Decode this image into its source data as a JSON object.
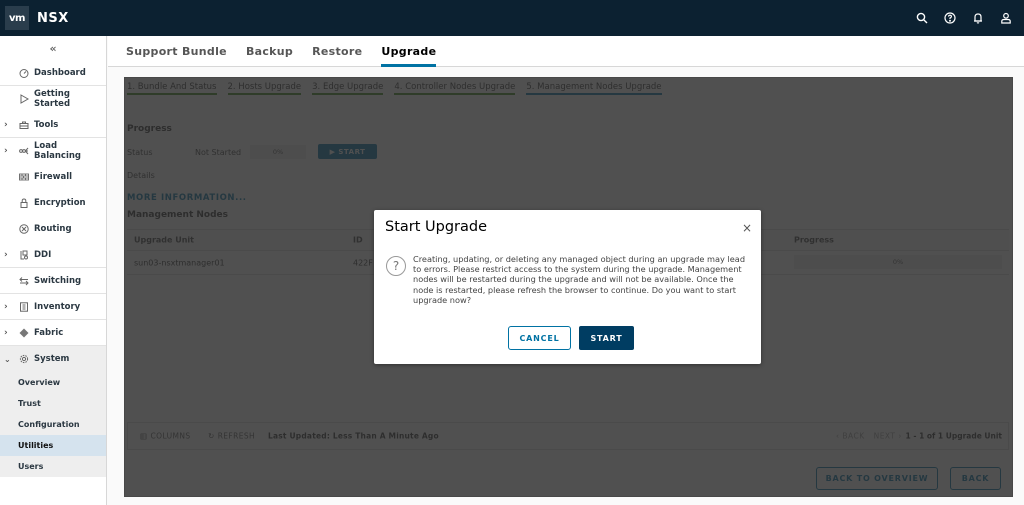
{
  "header": {
    "logo": "vm",
    "app_title": "NSX",
    "icons": [
      "search-icon",
      "help-icon",
      "bell-icon",
      "user-icon"
    ]
  },
  "sidebar": {
    "collapse_label": "«",
    "items": [
      {
        "label": "Dashboard",
        "icon": "dashboard-icon",
        "expandable": false
      },
      {
        "label": "Getting Started",
        "icon": "play-icon",
        "expandable": false
      },
      {
        "label": "Tools",
        "icon": "toolbox-icon",
        "expandable": true
      },
      {
        "label": "Load Balancing",
        "icon": "load-balancer-icon",
        "expandable": true
      },
      {
        "label": "Firewall",
        "icon": "firewall-icon",
        "expandable": false
      },
      {
        "label": "Encryption",
        "icon": "lock-icon",
        "expandable": false
      },
      {
        "label": "Routing",
        "icon": "routing-icon",
        "expandable": false
      },
      {
        "label": "DDI",
        "icon": "ddi-icon",
        "expandable": true
      },
      {
        "label": "Switching",
        "icon": "switching-icon",
        "expandable": false
      },
      {
        "label": "Inventory",
        "icon": "inventory-icon",
        "expandable": true
      },
      {
        "label": "Fabric",
        "icon": "fabric-icon",
        "expandable": true
      },
      {
        "label": "System",
        "icon": "gear-icon",
        "expandable": true,
        "expanded": true
      }
    ],
    "system_subitems": [
      {
        "label": "Overview",
        "active": false
      },
      {
        "label": "Trust",
        "active": false
      },
      {
        "label": "Configuration",
        "active": false
      },
      {
        "label": "Utilities",
        "active": true
      },
      {
        "label": "Users",
        "active": false
      }
    ]
  },
  "tabs": [
    {
      "label": "Support Bundle",
      "active": false
    },
    {
      "label": "Backup",
      "active": false
    },
    {
      "label": "Restore",
      "active": false
    },
    {
      "label": "Upgrade",
      "active": true
    }
  ],
  "upgrade": {
    "steps": [
      {
        "label": "1. Bundle And Status",
        "state": "complete"
      },
      {
        "label": "2. Hosts Upgrade",
        "state": "complete"
      },
      {
        "label": "3. Edge Upgrade",
        "state": "complete"
      },
      {
        "label": "4. Controller Nodes Upgrade",
        "state": "complete"
      },
      {
        "label": "5. Management Nodes Upgrade",
        "state": "current"
      }
    ],
    "progress_title": "Progress",
    "status_label": "Status",
    "status_value": "Not Started",
    "progress_percent": "0%",
    "start_button": "▶ START",
    "details_label": "Details",
    "more_info_link": "MORE INFORMATION...",
    "management_nodes_title": "Management Nodes",
    "table": {
      "columns": [
        "Upgrade Unit",
        "ID",
        "Progress"
      ],
      "rows": [
        {
          "upgrade_unit": "sun03-nsxtmanager01",
          "id": "422F",
          "progress": "0%"
        }
      ]
    },
    "footer": {
      "columns_label": "COLUMNS",
      "refresh_label": "REFRESH",
      "last_updated": "Last Updated: Less Than A Minute Ago",
      "back_label": "‹ BACK",
      "next_label": "NEXT ›",
      "count": "1 - 1 of 1 Upgrade Unit"
    },
    "back_to_overview_button": "BACK TO OVERVIEW",
    "back_button": "BACK"
  },
  "modal": {
    "title": "Start Upgrade",
    "close_label": "×",
    "icon": "question-icon",
    "body": "Creating, updating, or deleting any managed object during an upgrade may lead to errors. Please restrict access to the system during the upgrade. Management nodes will be restarted during the upgrade and will not be available. Once the node is restarted, please refresh the browser to continue. Do you want to start upgrade now?",
    "cancel_button": "CANCEL",
    "start_button": "START"
  },
  "colors": {
    "header_bg": "#0c2131",
    "accent": "#0072a3",
    "primary_button": "#003d62",
    "step_complete": "#3b8a1d",
    "active_nav_bg": "#d5e3ee"
  }
}
